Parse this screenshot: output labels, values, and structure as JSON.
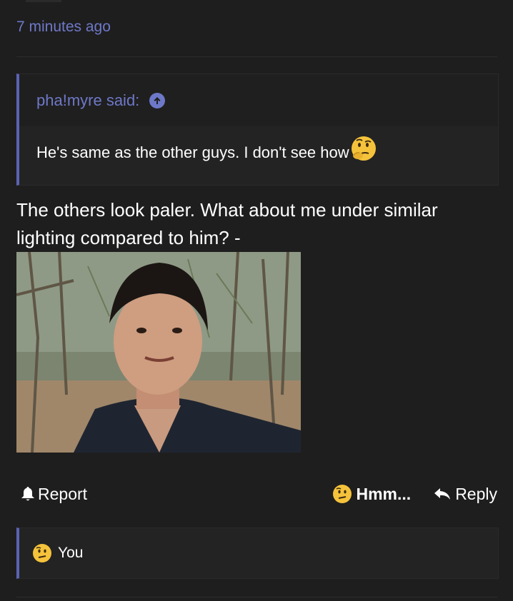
{
  "post": {
    "timestamp": "7 minutes ago",
    "text": "The others look paler. What about me under similar lighting compared to him? -"
  },
  "quote": {
    "author_label": "pha!myre said:",
    "body": "He's same as the other guys. I don't see how",
    "body_emoji": "thinking-face"
  },
  "actions": {
    "report_label": "Report",
    "reaction_label": "Hmm...",
    "reaction_emoji": "confused-face",
    "reply_label": "Reply"
  },
  "reactions": {
    "user_label": "You",
    "emoji": "confused-face"
  },
  "colors": {
    "background": "#1e1e1e",
    "accent": "#6e78c8",
    "quote_border": "#5b63b3",
    "emoji_yellow": "#f5c33b"
  }
}
